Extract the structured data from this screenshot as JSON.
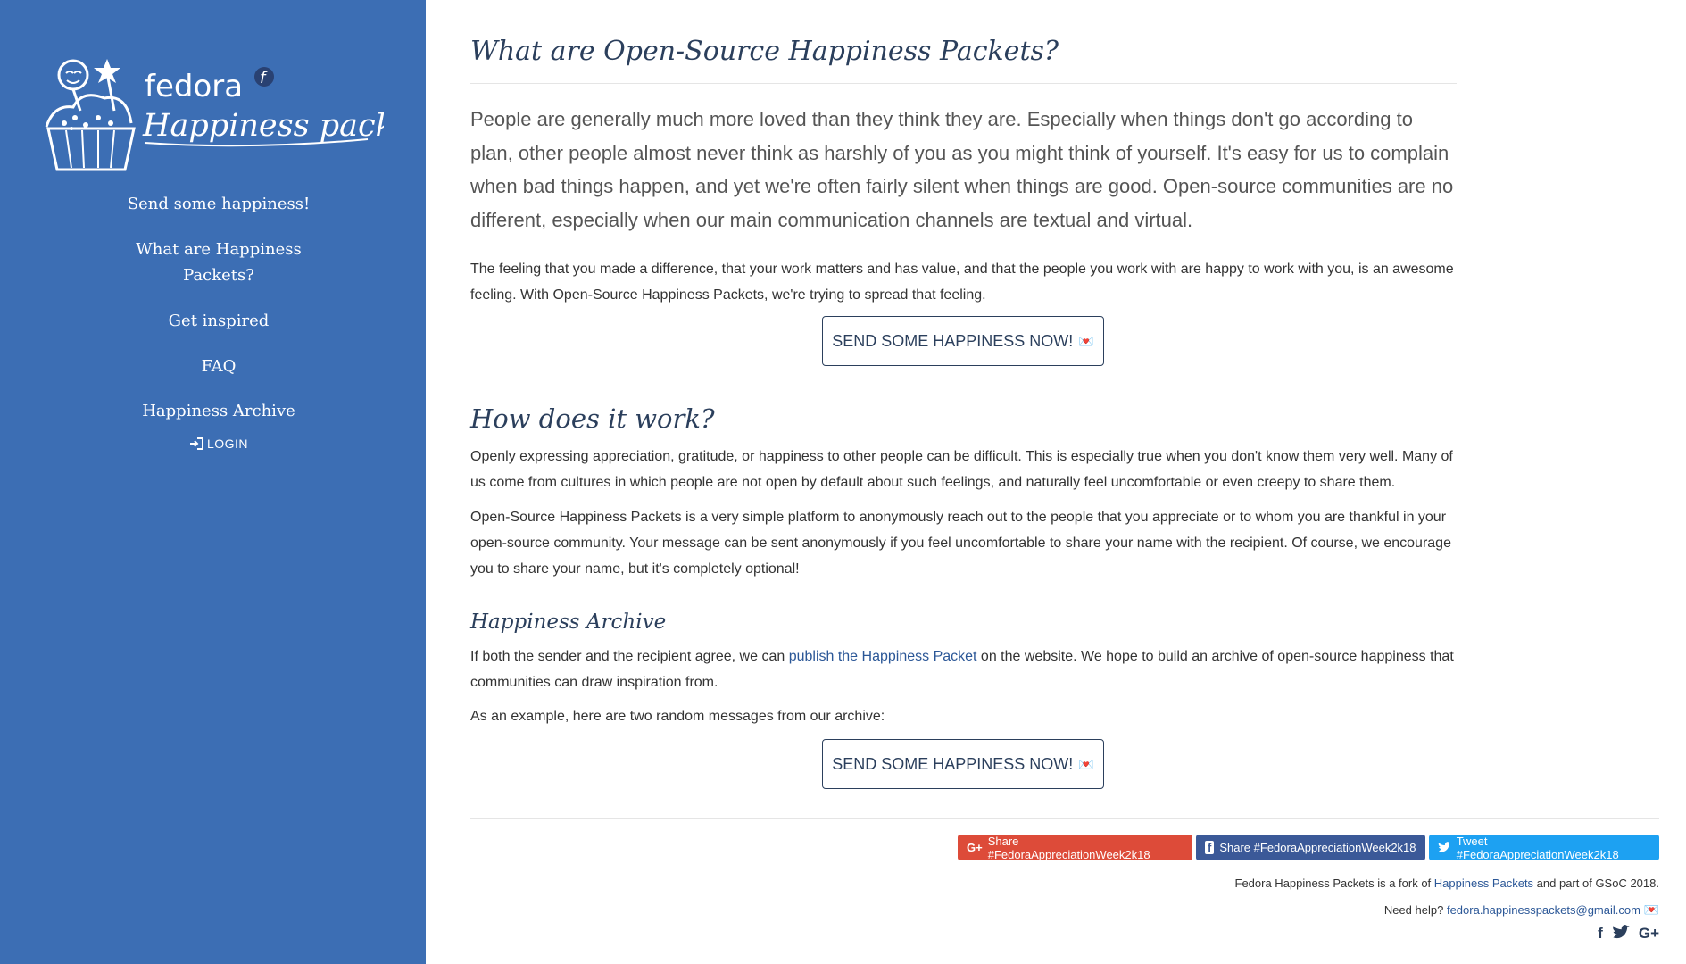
{
  "sidebar": {
    "logo": {
      "word1": "fedora",
      "word2": "Happiness packets",
      "badge": "f"
    },
    "nav": [
      {
        "label": "Send some happiness!"
      },
      {
        "label": "What are Happiness Packets?"
      },
      {
        "label": "Get inspired"
      },
      {
        "label": "FAQ"
      },
      {
        "label": "Happiness Archive"
      }
    ],
    "login": "LOGIN"
  },
  "main": {
    "title": "What are Open-Source Happiness Packets?",
    "lead": "People are generally much more loved than they think they are. Especially when things don't go according to plan, other people almost never think as harshly of you as you might think of yourself. It's easy for us to complain when bad things happen, and yet we're often fairly silent when things are good. Open-source communities are no different, especially when our main communication channels are textual and virtual.",
    "p1": "The feeling that you made a difference, that your work matters and has value, and that the people you work with are happy to work with you, is an awesome feeling. With Open-Source Happiness Packets, we're trying to spread that feeling.",
    "cta": "SEND SOME HAPPINESS NOW!",
    "cta_heart": "💌",
    "how_title": "How does it work?",
    "how_p1": "Openly expressing appreciation, gratitude, or happiness to other people can be difficult. This is especially true when you don't know them very well. Many of us come from cultures in which people are not open by default about such feelings, and naturally feel uncomfortable or even creepy to share them.",
    "how_p2": "Open-Source Happiness Packets is a very simple platform to anonymously reach out to the people that you appreciate or to whom you are thankful in your open-source community. Your message can be sent anonymously if you feel uncomfortable to share your name with the recipient. Of course, we encourage you to share your name, but it's completely optional!",
    "archive_title": "Happiness Archive",
    "archive_p1_pre": "If both the sender and the recipient agree, we can ",
    "archive_p1_link": "publish the Happiness Packet",
    "archive_p1_post": " on the website. We hope to build an archive of open-source happiness that communities can draw inspiration from.",
    "archive_p2": "As an example, here are two random messages from our archive:",
    "cta2": "SEND SOME HAPPINESS NOW!"
  },
  "footer": {
    "share_google": "Share #FedoraAppreciationWeek2k18",
    "share_facebook": "Share #FedoraAppreciationWeek2k18",
    "share_twitter": "Tweet #FedoraAppreciationWeek2k18",
    "fork_pre": "Fedora Happiness Packets is a fork of ",
    "fork_link": "Happiness Packets",
    "fork_post": " and part of GSoC 2018.",
    "help_pre": "Need help? ",
    "help_email": "fedora.happinesspackets@gmail.com",
    "help_heart": "💌"
  },
  "colors": {
    "sidebar": "#3c6eb4",
    "heading": "#2b3f5c",
    "google": "#dd4b39",
    "facebook": "#3b5998",
    "twitter": "#1da1f2"
  }
}
